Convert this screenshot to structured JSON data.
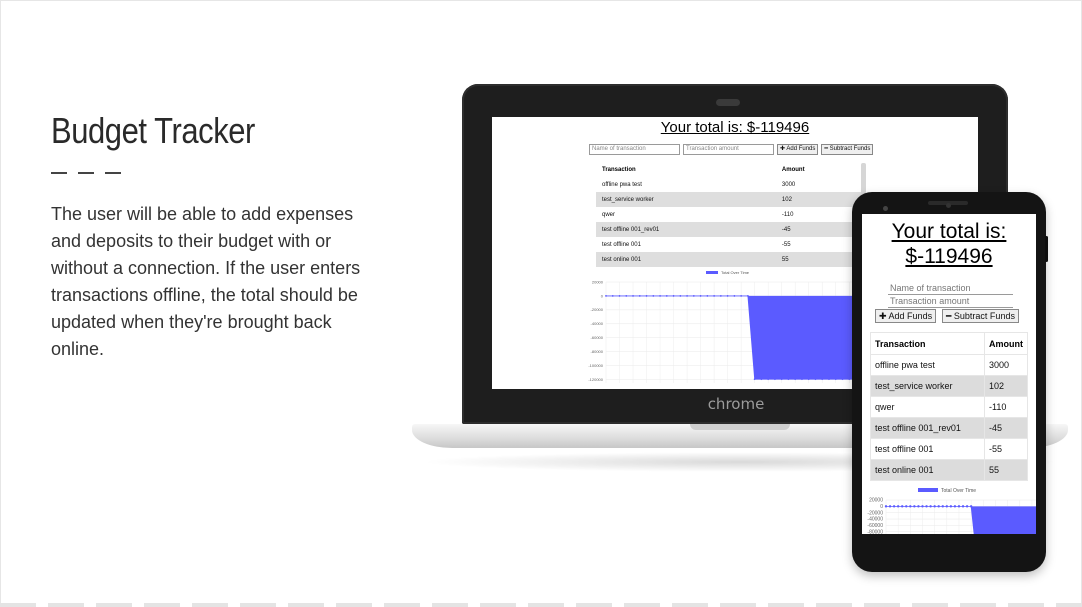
{
  "slide": {
    "title": "Budget Tracker",
    "body": "The user will be able to add expenses and deposits to their budget with or without a connection. If the user enters transactions offline, the total should be updated when they're brought back online."
  },
  "app": {
    "total_label": "Your total is: $-119496",
    "phone_total_line1": "Your total is:",
    "phone_total_line2": "$-119496",
    "name_placeholder": "Name of transaction",
    "amount_placeholder": "Transaction amount",
    "add_button": "✚ Add Funds",
    "subtract_button": "━ Subtract Funds",
    "columns": [
      "Transaction",
      "Amount"
    ],
    "transactions": [
      {
        "name": "offline pwa test",
        "amount": "3000"
      },
      {
        "name": "test_service worker",
        "amount": "102"
      },
      {
        "name": "qwer",
        "amount": "-110"
      },
      {
        "name": "test offline 001_rev01",
        "amount": "-45"
      },
      {
        "name": "test offline 001",
        "amount": "-55"
      },
      {
        "name": "test online 001",
        "amount": "55"
      }
    ],
    "chart_legend": "Total Over Time",
    "series_color": "#5b5bff"
  },
  "device": {
    "laptop_brand": "chrome"
  },
  "chart_data": {
    "type": "line",
    "title": "",
    "series": [
      {
        "name": "Total Over Time",
        "color": "#5b5bff",
        "values": [
          0,
          0,
          0,
          0,
          0,
          0,
          0,
          0,
          0,
          0,
          0,
          0,
          0,
          0,
          0,
          0,
          0,
          0,
          0,
          0,
          0,
          0,
          -119496,
          -119496,
          -119496,
          -119496,
          -119496,
          -119496,
          -119496,
          -119496,
          -119496,
          -119496,
          -119496,
          -119496,
          -119496,
          -119496,
          -119496,
          -119496
        ]
      }
    ],
    "ytick_labels": [
      "20000",
      "0",
      "-20000",
      "-40000",
      "-60000",
      "-80000",
      "-100000",
      "-120000"
    ],
    "ylim": [
      -125000,
      20000
    ],
    "fill": "area-to-zero",
    "grid": true,
    "legend_position": "top-center"
  }
}
